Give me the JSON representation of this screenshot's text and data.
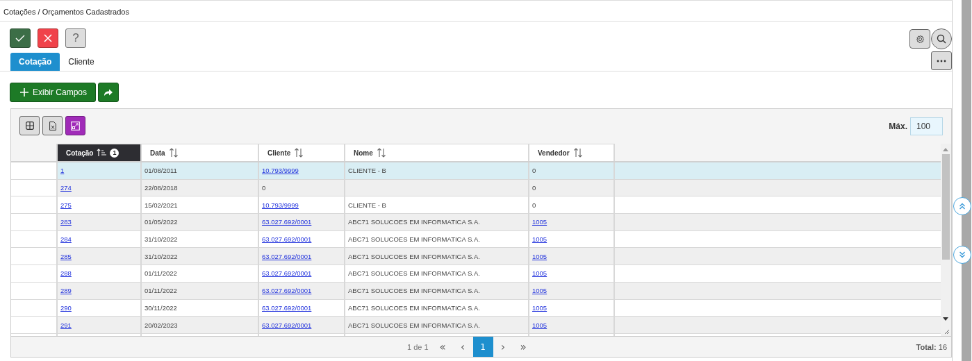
{
  "page_title": "Cotações / Orçamentos Cadastrados",
  "toolbar": [
    {
      "kind": "confirm"
    },
    {
      "kind": "cancel"
    },
    {
      "kind": "help",
      "label": "?"
    }
  ],
  "tabs": [
    {
      "label": "Cotação",
      "selected": true
    },
    {
      "label": "Cliente",
      "selected": false
    }
  ],
  "show_fields_button": "Exibir Campos",
  "max": {
    "label": "Máx.",
    "value": "100"
  },
  "columns": [
    {
      "label": "Cotação",
      "sorted": true,
      "sort_order": "1"
    },
    {
      "label": "Data",
      "sorted": false
    },
    {
      "label": "Cliente",
      "sorted": false
    },
    {
      "label": "Nome",
      "sorted": false
    },
    {
      "label": "Vendedor",
      "sorted": false
    }
  ],
  "rows": [
    {
      "selected": true,
      "cells": [
        {
          "text": "1",
          "link": true
        },
        {
          "text": "01/08/2011",
          "link": false
        },
        {
          "text": "10.793/9999",
          "link": true
        },
        {
          "text": "CLIENTE - B",
          "link": false
        },
        {
          "text": "0",
          "link": false
        }
      ]
    },
    {
      "selected": false,
      "cells": [
        {
          "text": "274",
          "link": true
        },
        {
          "text": "22/08/2018",
          "link": false
        },
        {
          "text": "0",
          "link": false
        },
        null,
        {
          "text": "0",
          "link": false
        }
      ]
    },
    {
      "selected": false,
      "cells": [
        {
          "text": "275",
          "link": true
        },
        {
          "text": "15/02/2021",
          "link": false
        },
        {
          "text": "10.793/9999",
          "link": true
        },
        {
          "text": "CLIENTE - B",
          "link": false
        },
        {
          "text": "0",
          "link": false
        }
      ]
    },
    {
      "selected": false,
      "cells": [
        {
          "text": "283",
          "link": true
        },
        {
          "text": "01/05/2022",
          "link": false
        },
        {
          "text": "63.027.692/0001",
          "link": true
        },
        {
          "text": "ABC71 SOLUCOES EM INFORMATICA S.A.",
          "link": false
        },
        {
          "text": "1005",
          "link": true
        }
      ]
    },
    {
      "selected": false,
      "cells": [
        {
          "text": "284",
          "link": true
        },
        {
          "text": "31/10/2022",
          "link": false
        },
        {
          "text": "63.027.692/0001",
          "link": true
        },
        {
          "text": "ABC71 SOLUCOES EM INFORMATICA S.A.",
          "link": false
        },
        {
          "text": "1005",
          "link": true
        }
      ]
    },
    {
      "selected": false,
      "cells": [
        {
          "text": "285",
          "link": true
        },
        {
          "text": "31/10/2022",
          "link": false
        },
        {
          "text": "63.027.692/0001",
          "link": true
        },
        {
          "text": "ABC71 SOLUCOES EM INFORMATICA S.A.",
          "link": false
        },
        {
          "text": "1005",
          "link": true
        }
      ]
    },
    {
      "selected": false,
      "cells": [
        {
          "text": "288",
          "link": true
        },
        {
          "text": "01/11/2022",
          "link": false
        },
        {
          "text": "63.027.692/0001",
          "link": true
        },
        {
          "text": "ABC71 SOLUCOES EM INFORMATICA S.A.",
          "link": false
        },
        {
          "text": "1005",
          "link": true
        }
      ]
    },
    {
      "selected": false,
      "cells": [
        {
          "text": "289",
          "link": true
        },
        {
          "text": "01/11/2022",
          "link": false
        },
        {
          "text": "63.027.692/0001",
          "link": true
        },
        {
          "text": "ABC71 SOLUCOES EM INFORMATICA S.A.",
          "link": false
        },
        {
          "text": "1005",
          "link": true
        }
      ]
    },
    {
      "selected": false,
      "cells": [
        {
          "text": "290",
          "link": true
        },
        {
          "text": "30/11/2022",
          "link": false
        },
        {
          "text": "63.027.692/0001",
          "link": true
        },
        {
          "text": "ABC71 SOLUCOES EM INFORMATICA S.A.",
          "link": false
        },
        {
          "text": "1005",
          "link": true
        }
      ]
    },
    {
      "selected": false,
      "cells": [
        {
          "text": "291",
          "link": true
        },
        {
          "text": "20/02/2023",
          "link": false
        },
        {
          "text": "63.027.692/0001",
          "link": true
        },
        {
          "text": "ABC71 SOLUCOES EM INFORMATICA S.A.",
          "link": false
        },
        {
          "text": "1005",
          "link": true
        }
      ]
    }
  ],
  "pager": {
    "info": "1 de 1",
    "first": "«",
    "prev": "‹",
    "pages": [
      {
        "label": "1",
        "selected": true
      }
    ],
    "next": "›",
    "last": "»"
  },
  "total": "**Total:** 16"
}
